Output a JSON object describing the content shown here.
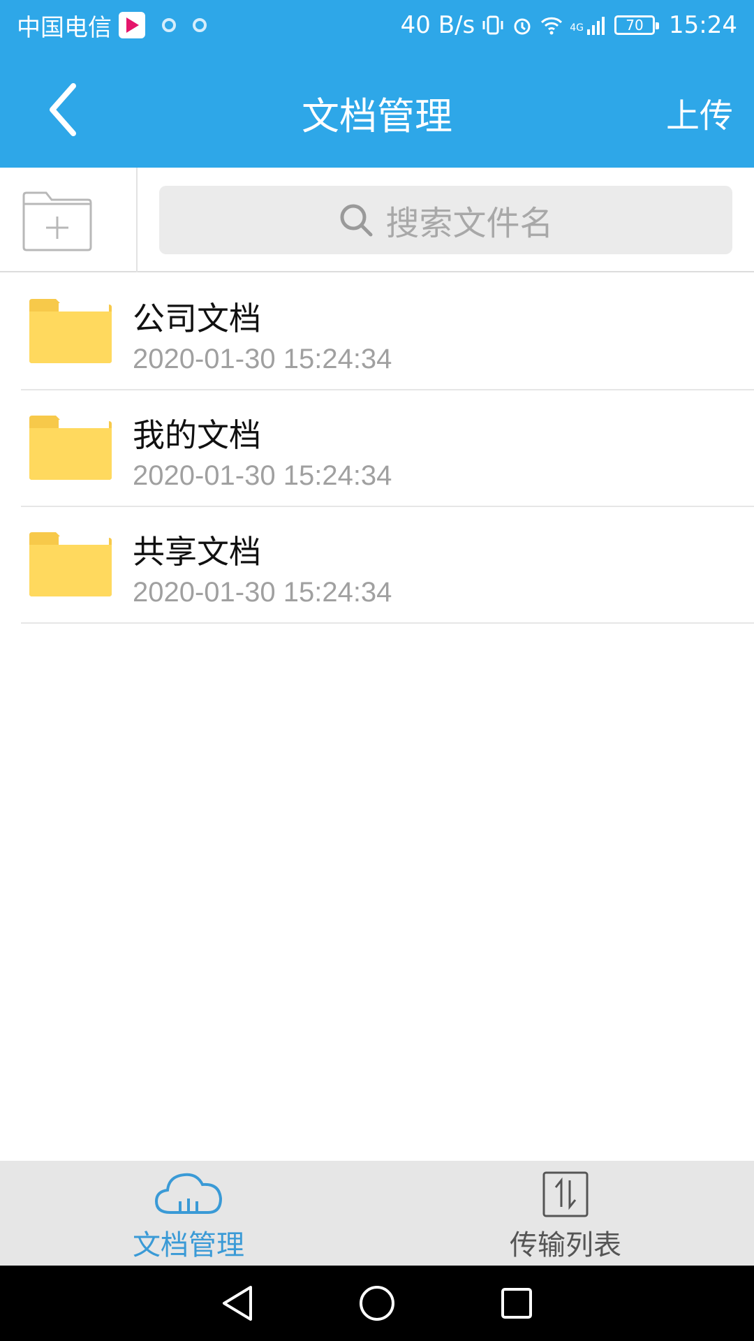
{
  "status_bar": {
    "carrier": "中国电信",
    "net_speed": "40 B/s",
    "battery": "70",
    "time": "15:24",
    "network": "4G"
  },
  "header": {
    "title": "文档管理",
    "upload_label": "上传",
    "background_color": "#2ea7e8"
  },
  "search": {
    "placeholder": "搜索文件名"
  },
  "files": [
    {
      "name": "公司文档",
      "time": "2020-01-30 15:24:34",
      "icon": "folder-icon"
    },
    {
      "name": "我的文档",
      "time": "2020-01-30 15:24:34",
      "icon": "folder-icon"
    },
    {
      "name": "共享文档",
      "time": "2020-01-30 15:24:34",
      "icon": "folder-icon"
    }
  ],
  "tabs": [
    {
      "label": "文档管理",
      "icon": "cloud-icon",
      "active": true,
      "color": "#3a9ad6"
    },
    {
      "label": "传输列表",
      "icon": "transfer-icon",
      "active": false,
      "color": "#555555"
    }
  ]
}
